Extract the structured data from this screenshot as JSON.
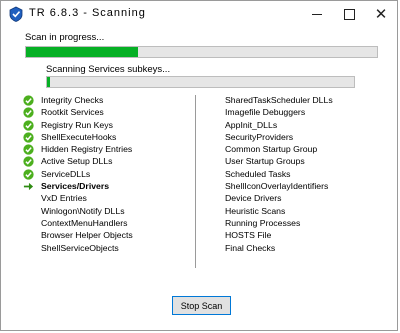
{
  "window": {
    "title": "TR 6.8.3  -  Scanning",
    "minimize_icon": "minimize-icon",
    "maximize_icon": "maximize-icon",
    "close_icon": "close-icon"
  },
  "scan": {
    "status_text": "Scan in progress...",
    "overall_progress": 0.32,
    "sub_status_text": "Scanning Services subkeys...",
    "sub_progress": 0.01,
    "progress_color": "#06b025"
  },
  "steps_left": [
    {
      "label": "Integrity Checks",
      "state": "done"
    },
    {
      "label": "Rootkit Services",
      "state": "done"
    },
    {
      "label": "Registry Run Keys",
      "state": "done"
    },
    {
      "label": "ShellExecuteHooks",
      "state": "done"
    },
    {
      "label": "Hidden Registry Entries",
      "state": "done"
    },
    {
      "label": "Active Setup DLLs",
      "state": "done"
    },
    {
      "label": "ServiceDLLs",
      "state": "done"
    },
    {
      "label": "Services/Drivers",
      "state": "current"
    },
    {
      "label": "VxD Entries",
      "state": "pending"
    },
    {
      "label": "Winlogon\\Notify DLLs",
      "state": "pending"
    },
    {
      "label": "ContextMenuHandlers",
      "state": "pending"
    },
    {
      "label": "Browser Helper Objects",
      "state": "pending"
    },
    {
      "label": "ShellServiceObjects",
      "state": "pending"
    }
  ],
  "steps_right": [
    {
      "label": "SharedTaskScheduler DLLs"
    },
    {
      "label": "Imagefile Debuggers"
    },
    {
      "label": "AppInit_DLLs"
    },
    {
      "label": "SecurityProviders"
    },
    {
      "label": "Common Startup Group"
    },
    {
      "label": "User Startup Groups"
    },
    {
      "label": "Scheduled Tasks"
    },
    {
      "label": "ShellIconOverlayIdentifiers"
    },
    {
      "label": "Device Drivers"
    },
    {
      "label": "Heuristic Scans"
    },
    {
      "label": "Running Processes"
    },
    {
      "label": "HOSTS File"
    },
    {
      "label": "Final Checks"
    }
  ],
  "icons": {
    "done": "check-circle-icon",
    "current": "arrow-right-icon",
    "done_color": "#4caf1e",
    "current_color": "#2e8b12"
  },
  "footer": {
    "stop_button_label": "Stop Scan"
  }
}
